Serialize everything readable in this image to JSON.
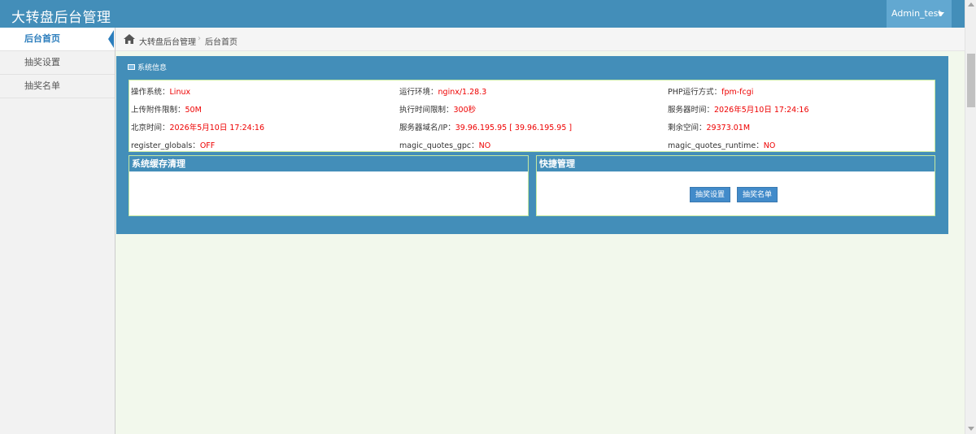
{
  "header": {
    "brand": "大转盘后台管理",
    "username": "Admin_test"
  },
  "sidebar": {
    "items": [
      {
        "label": "后台首页",
        "active": true
      },
      {
        "label": "抽奖设置",
        "active": false
      },
      {
        "label": "抽奖名单",
        "active": false
      }
    ]
  },
  "breadcrumb": {
    "home": "大转盘后台管理",
    "separator": "›",
    "current": "后台首页"
  },
  "panel": {
    "title": "系统信息",
    "info": [
      {
        "label": "操作系统：",
        "value": "Linux"
      },
      {
        "label": "运行环境：",
        "value": "nginx/1.28.3"
      },
      {
        "label": "PHP运行方式：",
        "value": "fpm-fcgi"
      },
      {
        "label": "上传附件限制：",
        "value": "50M"
      },
      {
        "label": "执行时间限制：",
        "value": "300秒"
      },
      {
        "label": "服务器时间：",
        "value": "2026年5月10日 17:24:16"
      },
      {
        "label": "北京时间：",
        "value": "2026年5月10日 17:24:16"
      },
      {
        "label": "服务器域名/IP：",
        "value": "39.96.195.95 [ 39.96.195.95 ]"
      },
      {
        "label": "剩余空间：",
        "value": "29373.01M"
      },
      {
        "label": "register_globals：",
        "value": "OFF"
      },
      {
        "label": "magic_quotes_gpc：",
        "value": "NO"
      },
      {
        "label": "magic_quotes_runtime：",
        "value": "NO"
      }
    ],
    "cache_title": "系统缓存清理",
    "quick_title": "快捷管理",
    "quick_buttons": [
      "抽奖设置",
      "抽奖名单"
    ]
  },
  "colors": {
    "header": "#438eb9",
    "accent": "#2b7dbc",
    "value_red": "#e00",
    "content_bg": "#f2f8ec"
  },
  "icons": {
    "home": "home-icon",
    "user_caret": "caret-down-icon",
    "panel": "window-icon"
  }
}
